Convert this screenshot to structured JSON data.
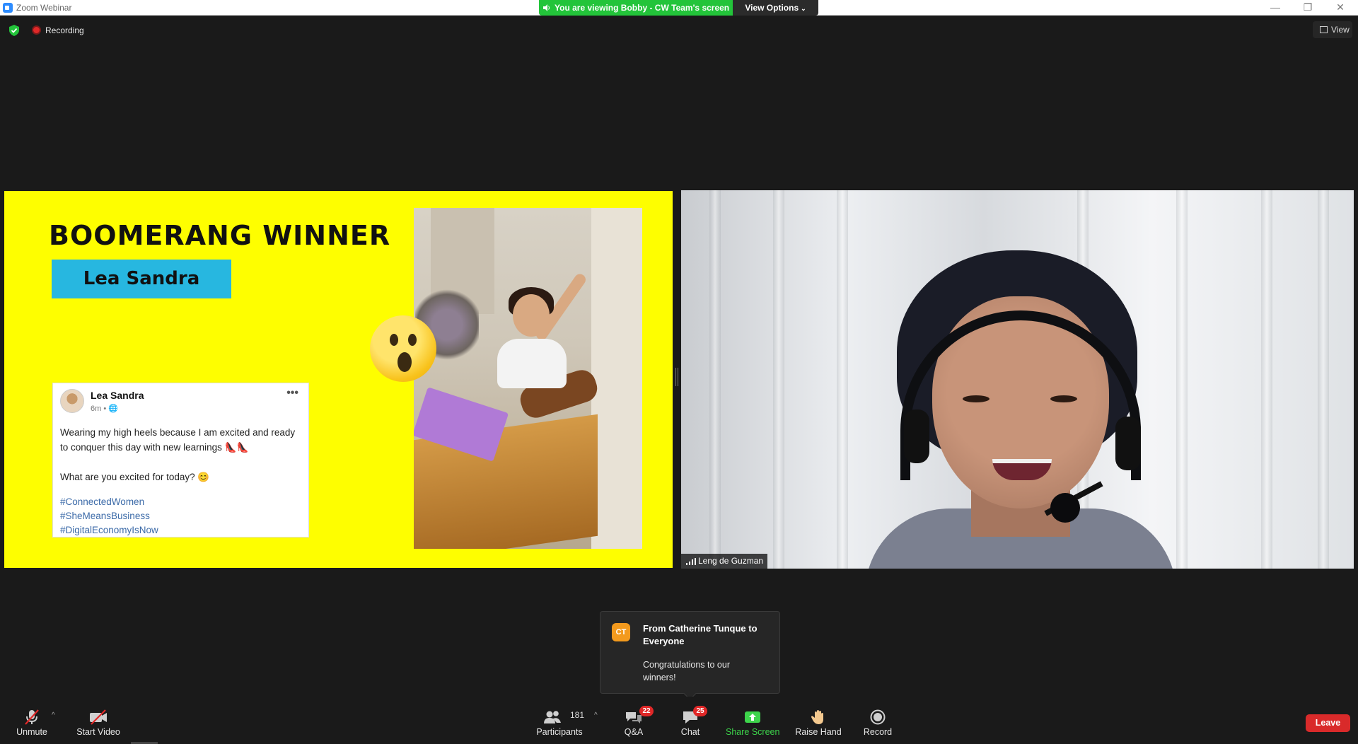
{
  "window": {
    "title": "Zoom Webinar",
    "minimize": "—",
    "restore": "❐",
    "close": "✕"
  },
  "banner": {
    "viewing_text": "You are viewing Bobby - CW Team's screen",
    "view_options_label": "View Options",
    "view_options_chevron": "⌄"
  },
  "meeting_bar": {
    "recording_label": "Recording",
    "view_label": "View"
  },
  "slide": {
    "title": "BOOMERANG WINNER",
    "winner_name": "Lea Sandra",
    "post": {
      "author": "Lea Sandra",
      "meta": "6m • 🌐",
      "more": "•••",
      "line1": "Wearing my high heels because I am excited and ready to conquer this day with new learnings 👠👠",
      "line2": "What are you excited for today? 😊",
      "hashtags": [
        "#ConnectedWomen",
        "#SheMeansBusiness",
        "#DigitalEconomyIsNow"
      ]
    }
  },
  "video": {
    "participant_name": "Leng de Guzman"
  },
  "chat_toast": {
    "avatar_initials": "CT",
    "from": "From Catherine Tunque to Everyone",
    "message": "Congratulations to our winners!"
  },
  "toolbar": {
    "unmute_label": "Unmute",
    "start_video_label": "Start Video",
    "participants_label": "Participants",
    "participants_count": "181",
    "qa_label": "Q&A",
    "qa_badge": "22",
    "chat_label": "Chat",
    "chat_badge": "25",
    "share_screen_label": "Share Screen",
    "raise_hand_label": "Raise Hand",
    "record_label": "Record",
    "leave_label": "Leave",
    "caret": "^"
  },
  "colors": {
    "banner_green": "#23c43a",
    "slide_yellow": "#fefe00",
    "name_box_blue": "#27b7e0",
    "leave_red": "#d92a2a",
    "badge_red": "#e02828",
    "toast_avatar_orange": "#f39a1d"
  }
}
